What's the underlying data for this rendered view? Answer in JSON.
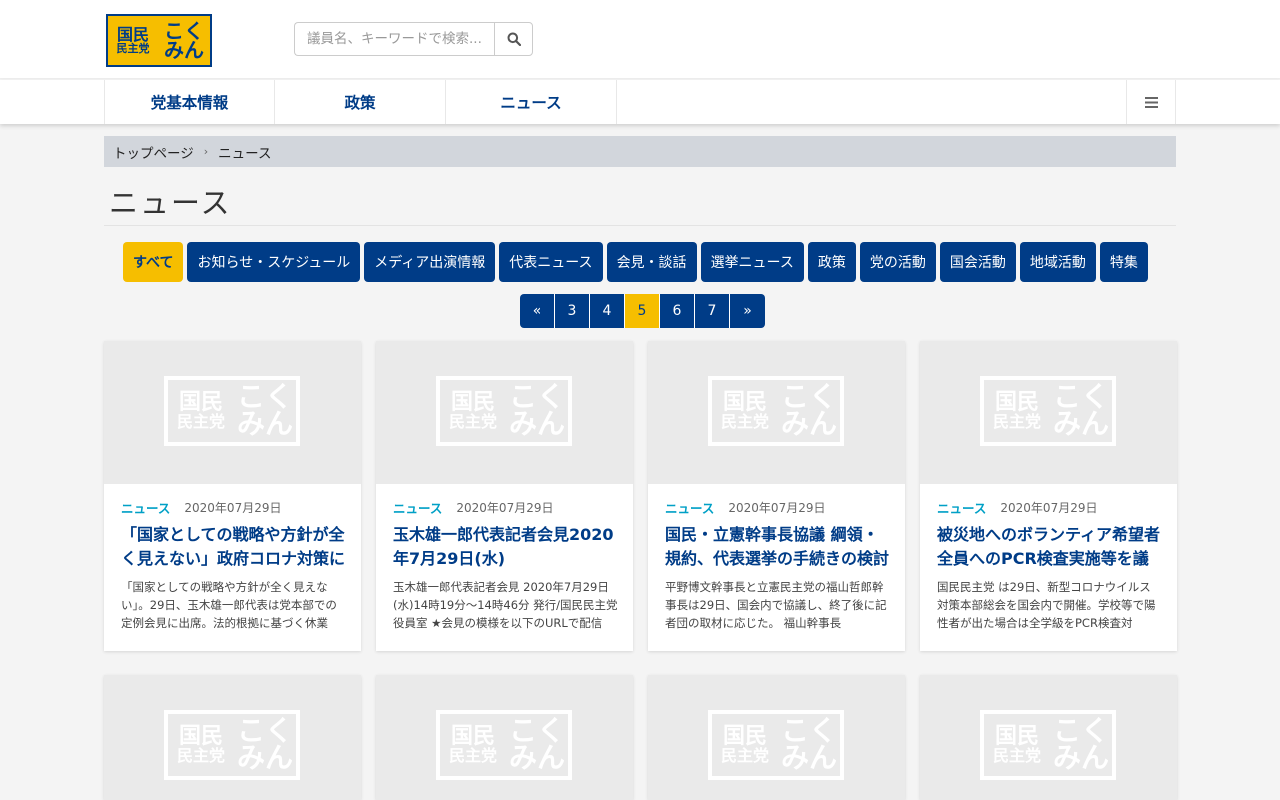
{
  "logo": {
    "line1": "国民",
    "line2": "民主党",
    "line3": "こく",
    "line4": "みん"
  },
  "search": {
    "placeholder": "議員名、キーワードで検索..."
  },
  "nav": {
    "items": [
      "党基本情報",
      "政策",
      "ニュース"
    ]
  },
  "breadcrumb": {
    "home": "トップページ",
    "current": "ニュース",
    "sep": "›"
  },
  "page_title": "ニュース",
  "categories": [
    "すべて",
    "お知らせ・スケジュール",
    "メディア出演情報",
    "代表ニュース",
    "会見・談話",
    "選挙ニュース",
    "政策",
    "党の活動",
    "国会活動",
    "地域活動",
    "特集"
  ],
  "active_category": "すべて",
  "pagination": [
    "«",
    "3",
    "4",
    "5",
    "6",
    "7",
    "»"
  ],
  "current_page": "5",
  "placeholder_logo": {
    "line1": "国民",
    "line2": "民主党",
    "line3": "こく",
    "line4": "みん"
  },
  "cards": [
    {
      "tag": "ニュース",
      "date": "2020年07月29日",
      "title": "「国家としての戦略や方針が全く見えない」政府コロナ対策に",
      "excerpt": "「国家としての戦略や方針が全く見えない」。29日、玉木雄一郎代表は党本部での定例会見に出席。法的根拠に基づく休業"
    },
    {
      "tag": "ニュース",
      "date": "2020年07月29日",
      "title": "玉木雄一郎代表記者会見2020年7月29日(水)",
      "excerpt": "玉木雄一郎代表記者会見 2020年7月29日(水)14時19分〜14時46分 発行/国民民主党役員室 ★会見の模様を以下のURLで配信"
    },
    {
      "tag": "ニュース",
      "date": "2020年07月29日",
      "title": "国民・立憲幹事長協議 綱領・規約、代表選挙の手続きの検討",
      "excerpt": "平野博文幹事長と立憲民主党の福山哲郎幹事長は29日、国会内で協議し、終了後に記者団の取材に応じた。 福山幹事長"
    },
    {
      "tag": "ニュース",
      "date": "2020年07月29日",
      "title": "被災地へのボランティア希望者全員へのPCR検査実施等を議",
      "excerpt": "国民民主党 は29日、新型コロナウイルス対策本部総会を国会内で開催。学校等で陽性者が出た場合は全学級をPCR検査対"
    }
  ],
  "colors": {
    "brand_navy": "#003c87",
    "brand_yellow": "#f6be00",
    "tag_cyan": "#00a0c6"
  }
}
